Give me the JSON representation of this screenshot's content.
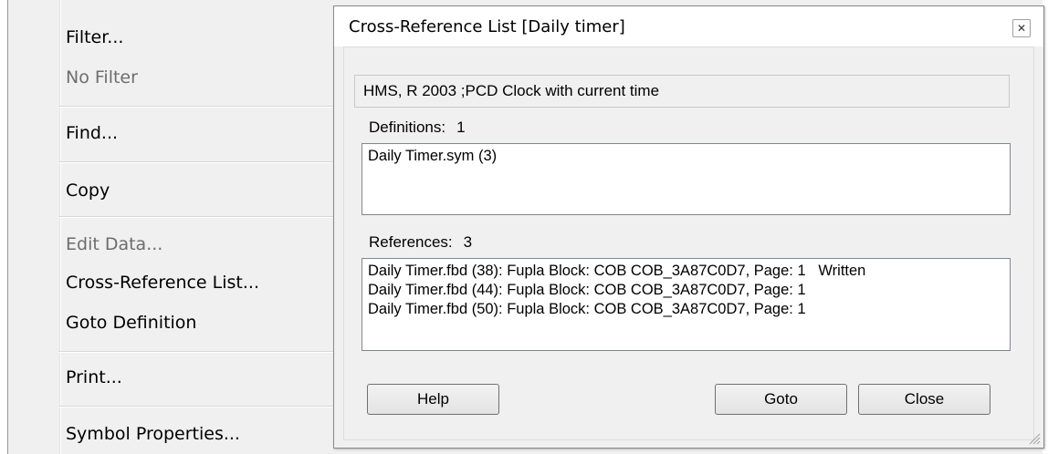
{
  "context_menu": {
    "items": [
      {
        "label": "Filter...",
        "enabled": true
      },
      {
        "label": "No Filter",
        "enabled": false
      },
      {
        "label": "Find...",
        "enabled": true
      },
      {
        "label": "Copy",
        "enabled": true
      },
      {
        "label": "Edit Data...",
        "enabled": false
      },
      {
        "label": "Cross-Reference List...",
        "enabled": true
      },
      {
        "label": "Goto Definition",
        "enabled": true
      },
      {
        "label": "Print...",
        "enabled": true
      },
      {
        "label": "Symbol Properties...",
        "enabled": true
      }
    ]
  },
  "dialog": {
    "title": "Cross-Reference List [Daily timer]",
    "close_icon": "close-x-icon",
    "symbol_info": "HMS, R 2003 ;PCD Clock with current time",
    "definitions": {
      "label": "Definitions:",
      "count": "1",
      "items": [
        "Daily Timer.sym (3)"
      ]
    },
    "references": {
      "label": "References:",
      "count": "3",
      "items": [
        "Daily Timer.fbd (38): Fupla Block: COB COB_3A87C0D7, Page: 1   Written",
        "Daily Timer.fbd (44): Fupla Block: COB COB_3A87C0D7, Page: 1",
        "Daily Timer.fbd (50): Fupla Block: COB COB_3A87C0D7, Page: 1"
      ]
    },
    "buttons": {
      "help": "Help",
      "goto": "Goto",
      "close": "Close"
    }
  }
}
